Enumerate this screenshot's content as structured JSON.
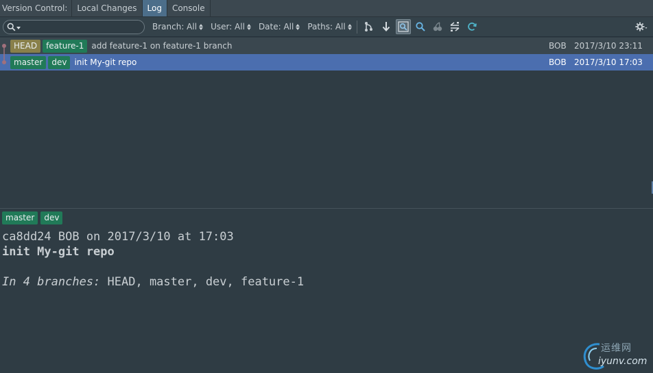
{
  "tabs": {
    "label": "Version Control:",
    "items": [
      {
        "label": "Local Changes"
      },
      {
        "label": "Log"
      },
      {
        "label": "Console"
      }
    ]
  },
  "toolbar": {
    "search_placeholder": "",
    "filters": {
      "branch": "Branch: All",
      "user": "User: All",
      "date": "Date: All",
      "paths": "Paths: All"
    },
    "buttons": [
      "graph-icon",
      "goto-icon",
      "highlight-icon",
      "search-icon",
      "cherry-pick-icon",
      "diff-icon",
      "refresh-icon",
      "gear-icon"
    ]
  },
  "log": {
    "rows": [
      {
        "refs": [
          {
            "name": "HEAD",
            "kind": "head"
          },
          {
            "name": "feature-1",
            "kind": "branch"
          }
        ],
        "message": "add feature-1 on feature-1 branch",
        "author": "BOB",
        "date": "2017/3/10 23:11"
      },
      {
        "refs": [
          {
            "name": "master",
            "kind": "branch"
          },
          {
            "name": "dev",
            "kind": "branch"
          }
        ],
        "message": "init My-git repo",
        "author": "BOB",
        "date": "2017/3/10 17:03",
        "selected": true
      }
    ]
  },
  "details": {
    "tags": [
      "master",
      "dev"
    ],
    "hash_line": "ca8dd24 BOB on 2017/3/10 at 17:03",
    "subject": "init My-git repo",
    "branches_prefix": "In 4 branches:",
    "branches_list": " HEAD, master, dev, feature-1"
  },
  "watermark": {
    "cn": "运维网",
    "url": "iyunv.com"
  },
  "colors": {
    "background": "#2f3c44",
    "selection": "#4b6eaf",
    "active_tab": "#4c6e8a",
    "head_tag": "#89804a",
    "branch_tag": "#217a58"
  }
}
